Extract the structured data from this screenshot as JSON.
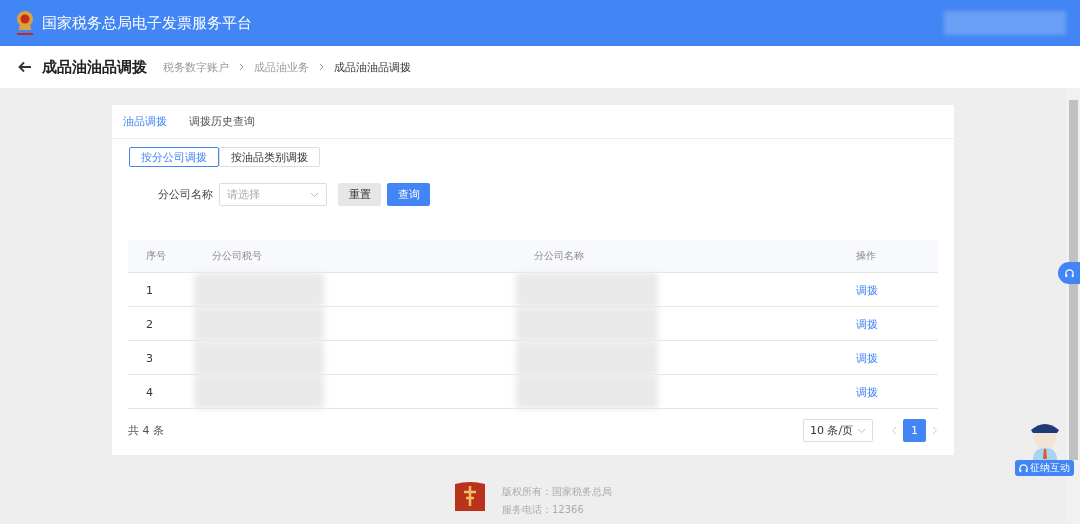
{
  "header": {
    "title": "国家税务总局电子发票服务平台"
  },
  "page": {
    "title": "成品油油品调拨",
    "breadcrumb": [
      "税务数字账户",
      "成品油业务",
      "成品油油品调拨"
    ]
  },
  "tabs": [
    {
      "label": "油品调拨",
      "selected": true
    },
    {
      "label": "调拨历史查询",
      "selected": false
    }
  ],
  "modes": [
    {
      "label": "按分公司调拨",
      "selected": true
    },
    {
      "label": "按油品类别调拨",
      "selected": false
    }
  ],
  "filter": {
    "label": "分公司名称",
    "placeholder": "请选择",
    "buttons": [
      {
        "label": "重置",
        "kind": "plain"
      },
      {
        "label": "查询",
        "kind": "primary"
      }
    ]
  },
  "table": {
    "columns": [
      "序号",
      "分公司税号",
      "分公司名称",
      "操作"
    ],
    "rows": [
      {
        "index": "1",
        "action": "调拨"
      },
      {
        "index": "2",
        "action": "调拨"
      },
      {
        "index": "3",
        "action": "调拨"
      },
      {
        "index": "4",
        "action": "调拨"
      }
    ]
  },
  "pagination": {
    "total": "共 4 条",
    "page_size": "10 条/页",
    "pages": [
      {
        "label": "1",
        "selected": true
      }
    ]
  },
  "assistant": {
    "label": "征纳互动"
  },
  "footer": {
    "lines": [
      "版权所有：国家税务总局",
      "服务电话：12366"
    ]
  }
}
